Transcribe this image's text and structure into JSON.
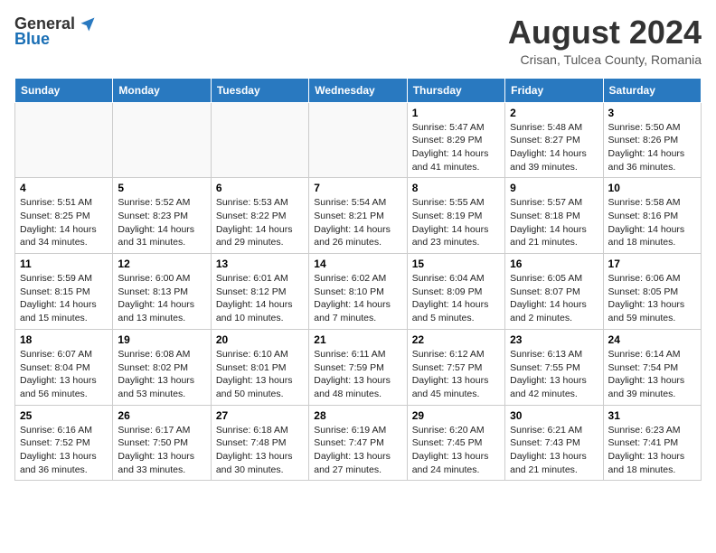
{
  "logo": {
    "general": "General",
    "blue": "Blue"
  },
  "title": "August 2024",
  "location": "Crisan, Tulcea County, Romania",
  "days_header": [
    "Sunday",
    "Monday",
    "Tuesday",
    "Wednesday",
    "Thursday",
    "Friday",
    "Saturday"
  ],
  "weeks": [
    [
      {
        "day": "",
        "info": ""
      },
      {
        "day": "",
        "info": ""
      },
      {
        "day": "",
        "info": ""
      },
      {
        "day": "",
        "info": ""
      },
      {
        "day": "1",
        "sunrise": "5:47 AM",
        "sunset": "8:29 PM",
        "daylight": "14 hours and 41 minutes."
      },
      {
        "day": "2",
        "sunrise": "5:48 AM",
        "sunset": "8:27 PM",
        "daylight": "14 hours and 39 minutes."
      },
      {
        "day": "3",
        "sunrise": "5:50 AM",
        "sunset": "8:26 PM",
        "daylight": "14 hours and 36 minutes."
      }
    ],
    [
      {
        "day": "4",
        "sunrise": "5:51 AM",
        "sunset": "8:25 PM",
        "daylight": "14 hours and 34 minutes."
      },
      {
        "day": "5",
        "sunrise": "5:52 AM",
        "sunset": "8:23 PM",
        "daylight": "14 hours and 31 minutes."
      },
      {
        "day": "6",
        "sunrise": "5:53 AM",
        "sunset": "8:22 PM",
        "daylight": "14 hours and 29 minutes."
      },
      {
        "day": "7",
        "sunrise": "5:54 AM",
        "sunset": "8:21 PM",
        "daylight": "14 hours and 26 minutes."
      },
      {
        "day": "8",
        "sunrise": "5:55 AM",
        "sunset": "8:19 PM",
        "daylight": "14 hours and 23 minutes."
      },
      {
        "day": "9",
        "sunrise": "5:57 AM",
        "sunset": "8:18 PM",
        "daylight": "14 hours and 21 minutes."
      },
      {
        "day": "10",
        "sunrise": "5:58 AM",
        "sunset": "8:16 PM",
        "daylight": "14 hours and 18 minutes."
      }
    ],
    [
      {
        "day": "11",
        "sunrise": "5:59 AM",
        "sunset": "8:15 PM",
        "daylight": "14 hours and 15 minutes."
      },
      {
        "day": "12",
        "sunrise": "6:00 AM",
        "sunset": "8:13 PM",
        "daylight": "14 hours and 13 minutes."
      },
      {
        "day": "13",
        "sunrise": "6:01 AM",
        "sunset": "8:12 PM",
        "daylight": "14 hours and 10 minutes."
      },
      {
        "day": "14",
        "sunrise": "6:02 AM",
        "sunset": "8:10 PM",
        "daylight": "14 hours and 7 minutes."
      },
      {
        "day": "15",
        "sunrise": "6:04 AM",
        "sunset": "8:09 PM",
        "daylight": "14 hours and 5 minutes."
      },
      {
        "day": "16",
        "sunrise": "6:05 AM",
        "sunset": "8:07 PM",
        "daylight": "14 hours and 2 minutes."
      },
      {
        "day": "17",
        "sunrise": "6:06 AM",
        "sunset": "8:05 PM",
        "daylight": "13 hours and 59 minutes."
      }
    ],
    [
      {
        "day": "18",
        "sunrise": "6:07 AM",
        "sunset": "8:04 PM",
        "daylight": "13 hours and 56 minutes."
      },
      {
        "day": "19",
        "sunrise": "6:08 AM",
        "sunset": "8:02 PM",
        "daylight": "13 hours and 53 minutes."
      },
      {
        "day": "20",
        "sunrise": "6:10 AM",
        "sunset": "8:01 PM",
        "daylight": "13 hours and 50 minutes."
      },
      {
        "day": "21",
        "sunrise": "6:11 AM",
        "sunset": "7:59 PM",
        "daylight": "13 hours and 48 minutes."
      },
      {
        "day": "22",
        "sunrise": "6:12 AM",
        "sunset": "7:57 PM",
        "daylight": "13 hours and 45 minutes."
      },
      {
        "day": "23",
        "sunrise": "6:13 AM",
        "sunset": "7:55 PM",
        "daylight": "13 hours and 42 minutes."
      },
      {
        "day": "24",
        "sunrise": "6:14 AM",
        "sunset": "7:54 PM",
        "daylight": "13 hours and 39 minutes."
      }
    ],
    [
      {
        "day": "25",
        "sunrise": "6:16 AM",
        "sunset": "7:52 PM",
        "daylight": "13 hours and 36 minutes."
      },
      {
        "day": "26",
        "sunrise": "6:17 AM",
        "sunset": "7:50 PM",
        "daylight": "13 hours and 33 minutes."
      },
      {
        "day": "27",
        "sunrise": "6:18 AM",
        "sunset": "7:48 PM",
        "daylight": "13 hours and 30 minutes."
      },
      {
        "day": "28",
        "sunrise": "6:19 AM",
        "sunset": "7:47 PM",
        "daylight": "13 hours and 27 minutes."
      },
      {
        "day": "29",
        "sunrise": "6:20 AM",
        "sunset": "7:45 PM",
        "daylight": "13 hours and 24 minutes."
      },
      {
        "day": "30",
        "sunrise": "6:21 AM",
        "sunset": "7:43 PM",
        "daylight": "13 hours and 21 minutes."
      },
      {
        "day": "31",
        "sunrise": "6:23 AM",
        "sunset": "7:41 PM",
        "daylight": "13 hours and 18 minutes."
      }
    ]
  ]
}
